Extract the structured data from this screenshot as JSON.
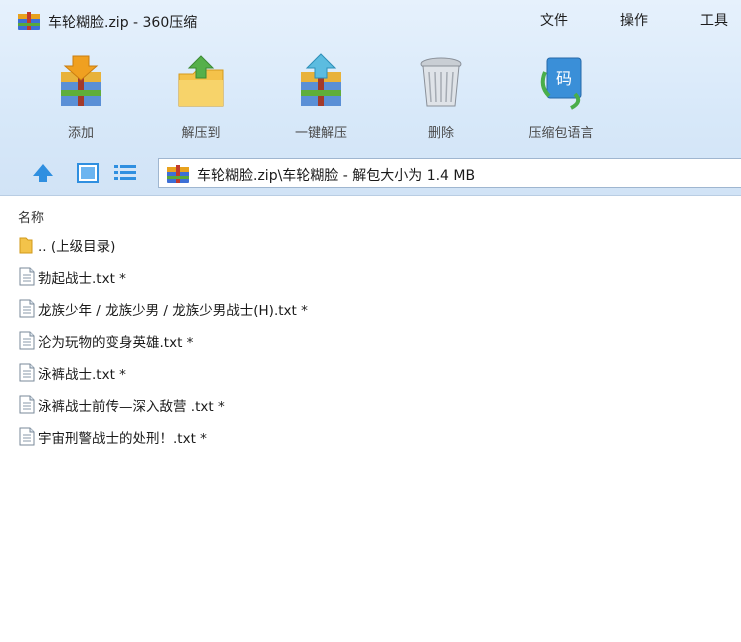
{
  "window": {
    "title": "车轮糊脸.zip - 360压缩",
    "menu": [
      "文件",
      "操作",
      "工具"
    ]
  },
  "toolbar": {
    "items": [
      {
        "label": "添加",
        "icon": "add-icon"
      },
      {
        "label": "解压到",
        "icon": "extract-to-icon"
      },
      {
        "label": "一键解压",
        "icon": "one-click-extract-icon"
      },
      {
        "label": "删除",
        "icon": "delete-icon"
      },
      {
        "label": "压缩包语言",
        "icon": "archive-language-icon"
      }
    ]
  },
  "nav": {
    "address": "车轮糊脸.zip\\车轮糊脸 - 解包大小为 1.4 MB"
  },
  "list": {
    "column_name": "名称",
    "items": [
      {
        "name": ".. (上级目录)",
        "type": "folder"
      },
      {
        "name": "勃起战士.txt *",
        "type": "file"
      },
      {
        "name": "龙族少年 / 龙族少男 / 龙族少男战士(H).txt *",
        "type": "file"
      },
      {
        "name": "沦为玩物的变身英雄.txt *",
        "type": "file"
      },
      {
        "name": "泳裤战士.txt *",
        "type": "file"
      },
      {
        "name": "泳裤战士前传—深入敌营 .txt *",
        "type": "file"
      },
      {
        "name": "宇宙刑警战士的处刑！.txt *",
        "type": "file"
      }
    ]
  },
  "colors": {
    "chrome_bg": "#d7e8f9",
    "address_border": "#9fb6d0",
    "accent_blue": "#3a8fd8"
  }
}
